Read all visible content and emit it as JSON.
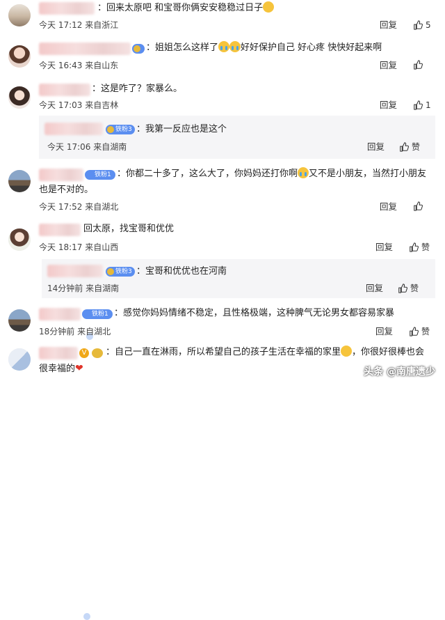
{
  "comments": [
    {
      "text_before": "：回来太原吧  和宝哥你俩安安稳稳过日子",
      "emoji": "hug-emoji",
      "time": "今天 17:12",
      "location": "来自浙江",
      "reply": "回复",
      "likes": "5"
    },
    {
      "text_before": "：姐姐怎么这样了",
      "text_after": "好好保护自己 好心疼 快快好起来啊",
      "time": "今天 16:43",
      "location": "来自山东",
      "reply": "回复",
      "likes": ""
    },
    {
      "text": "：这是咋了？家暴么。",
      "time": "今天 17:03",
      "location": "来自吉林",
      "reply": "回复",
      "likes": "1",
      "sub": {
        "badge": "铁粉3",
        "text": "：我第一反应也是这个",
        "time": "今天 17:06",
        "location": "来自湖南",
        "reply": "回复",
        "like": "赞"
      }
    },
    {
      "badge": "铁粉1",
      "text_line1_before": "：你都二十多了，这么大了，你妈妈还打你啊",
      "text_line1_after": "又不是小朋友，当然打小朋友",
      "text_line2": "也是不对的。",
      "time": "今天 17:52",
      "location": "来自湖北",
      "reply": "回复",
      "likes": ""
    },
    {
      "text": "回太原，找宝哥和优优",
      "time": "今天 18:17",
      "location": "来自山西",
      "reply": "回复",
      "like": "赞",
      "sub": {
        "badge": "铁粉3",
        "text": "：宝哥和优优也在河南",
        "time": "14分钟前",
        "location": "来自湖南",
        "reply": "回复",
        "like": "赞"
      }
    },
    {
      "badge": "铁粉1",
      "text": "：感觉你妈妈情绪不稳定，且性格极端，这种脾气无论男女都容易家暴",
      "time": "18分钟前",
      "location": "来自湖北",
      "reply": "回复",
      "like": "赞"
    },
    {
      "text_before": "：自己一直在淋雨，所以希望自己的孩子生活在幸福的家里",
      "text_after": "，你很好很棒也会",
      "text_line2": "很幸福的"
    }
  ],
  "watermark": "头条 @南唐遗少",
  "colors": {
    "badge": "#5b8ef0",
    "panel": "#f5f5f7",
    "blur_name": "#f3c9c9"
  }
}
